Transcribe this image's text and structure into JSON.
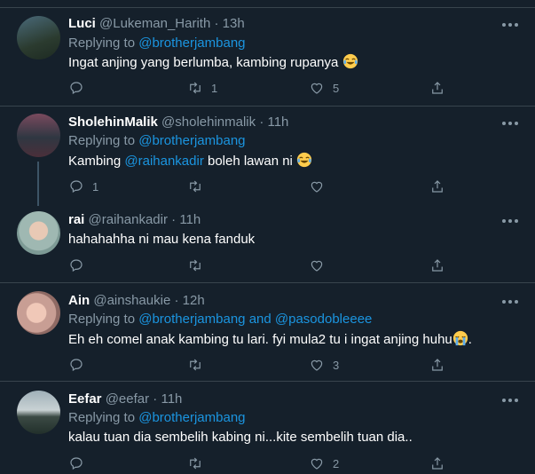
{
  "tweets": [
    {
      "name": "Luci",
      "handle": "@Lukeman_Harith",
      "sep": "·",
      "time": "13h",
      "replying_to": "Replying to",
      "mentions": [
        "@brotherjambang"
      ],
      "text_before": "Ingat anjing yang berlumba, kambing rupanya",
      "text_mention": "",
      "text_after": "",
      "emoji": "joy-emoji",
      "counts": {
        "reply": "",
        "retweet": "1",
        "like": "5"
      }
    },
    {
      "name": "SholehinMalik",
      "handle": "@sholehinmalik",
      "sep": "·",
      "time": "11h",
      "replying_to": "Replying to",
      "mentions": [
        "@brotherjambang"
      ],
      "text_before": "Kambing",
      "text_mention": "@raihankadir",
      "text_after": "boleh lawan ni",
      "emoji": "joy-emoji",
      "counts": {
        "reply": "1",
        "retweet": "",
        "like": ""
      }
    },
    {
      "name": "rai",
      "handle": "@raihankadir",
      "sep": "·",
      "time": "11h",
      "text_before": "hahahahha ni mau kena fanduk",
      "counts": {
        "reply": "",
        "retweet": "",
        "like": ""
      }
    },
    {
      "name": "Ain",
      "handle": "@ainshaukie",
      "sep": "·",
      "time": "12h",
      "replying_to": "Replying to",
      "mentions": [
        "@brotherjambang",
        "and",
        "@pasodobleeee"
      ],
      "text_before": "Eh eh comel anak kambing tu lari. fyi mula2 tu i ingat anjing huhu",
      "text_after": ".",
      "emoji": "sob-emoji",
      "counts": {
        "reply": "",
        "retweet": "",
        "like": "3"
      }
    },
    {
      "name": "Eefar",
      "handle": "@eefar",
      "sep": "·",
      "time": "11h",
      "replying_to": "Replying to",
      "mentions": [
        "@brotherjambang"
      ],
      "text_before": "kalau tuan dia sembelih kabing ni...kite sembelih tuan dia..",
      "counts": {
        "reply": "",
        "retweet": "",
        "like": "2"
      }
    }
  ],
  "colors": {
    "background": "#15202b",
    "link": "#1b95e0",
    "muted": "#8899a6",
    "text": "#ffffff",
    "divider": "#38444d"
  }
}
